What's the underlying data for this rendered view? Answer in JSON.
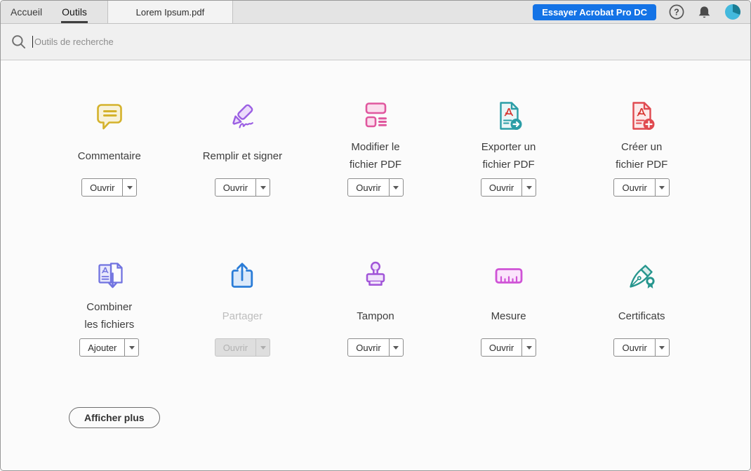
{
  "tabs": {
    "items": [
      {
        "label": "Accueil",
        "active": false
      },
      {
        "label": "Outils",
        "active": true
      }
    ],
    "document_tab": "Lorem Ipsum.pdf"
  },
  "header": {
    "try_button": "Essayer Acrobat Pro DC",
    "icons": [
      "question-mark-icon",
      "bell-icon",
      "avatar"
    ],
    "avatar_colors": [
      "#43b9dd",
      "#1a7c93"
    ]
  },
  "search": {
    "placeholder": "Outils de recherche",
    "icon": "search-icon"
  },
  "tools": [
    {
      "id": "commentaire",
      "lines": [
        "Commentaire"
      ],
      "button": "Ouvrir",
      "disabled": false,
      "icon": "comment-icon",
      "color": "#d4b22c",
      "fill": "#f8f2d9"
    },
    {
      "id": "remplir-et-signer",
      "lines": [
        "Remplir et signer"
      ],
      "button": "Ouvrir",
      "disabled": false,
      "icon": "fill-sign-icon",
      "color": "#9b5fe3",
      "fill": "#ecdcfb"
    },
    {
      "id": "modifier-pdf",
      "lines": [
        "Modifier le",
        "fichier PDF"
      ],
      "button": "Ouvrir",
      "disabled": false,
      "icon": "edit-pdf-icon",
      "color": "#e0579e",
      "fill": "#fbdeee"
    },
    {
      "id": "exporter-pdf",
      "lines": [
        "Exporter un",
        "fichier PDF"
      ],
      "button": "Ouvrir",
      "disabled": false,
      "icon": "export-pdf-icon",
      "color": "#2b9da6",
      "fill": "#eaf6f7"
    },
    {
      "id": "creer-pdf",
      "lines": [
        "Créer un",
        "fichier PDF"
      ],
      "button": "Ouvrir",
      "disabled": false,
      "icon": "create-pdf-icon",
      "color": "#e04a50",
      "fill": "#fceaea"
    },
    {
      "id": "combiner",
      "lines": [
        "Combiner",
        "les fichiers"
      ],
      "button": "Ajouter",
      "disabled": false,
      "icon": "combine-icon",
      "color": "#7173e0",
      "fill": "#e9e9fc"
    },
    {
      "id": "partager",
      "lines": [
        "Partager"
      ],
      "button": "Ouvrir",
      "disabled": true,
      "icon": "share-icon",
      "color": "#2a7cd7",
      "fill": "#dbe9fa"
    },
    {
      "id": "tampon",
      "lines": [
        "Tampon"
      ],
      "button": "Ouvrir",
      "disabled": false,
      "icon": "stamp-icon",
      "color": "#a155d8",
      "fill": "#f1e4fb"
    },
    {
      "id": "mesure",
      "lines": [
        "Mesure"
      ],
      "button": "Ouvrir",
      "disabled": false,
      "icon": "measure-icon",
      "color": "#cf53d6",
      "fill": "#fbe4fc"
    },
    {
      "id": "certificats",
      "lines": [
        "Certificats"
      ],
      "button": "Ouvrir",
      "disabled": false,
      "icon": "certificate-icon",
      "color": "#27968e",
      "fill": "#d9edeb"
    }
  ],
  "footer": {
    "show_more": "Afficher plus"
  },
  "colors": {
    "accent_blue": "#1473e6",
    "adobe_logo_red": "#d7322d",
    "active_tab_underline": "#3f3f3f"
  }
}
